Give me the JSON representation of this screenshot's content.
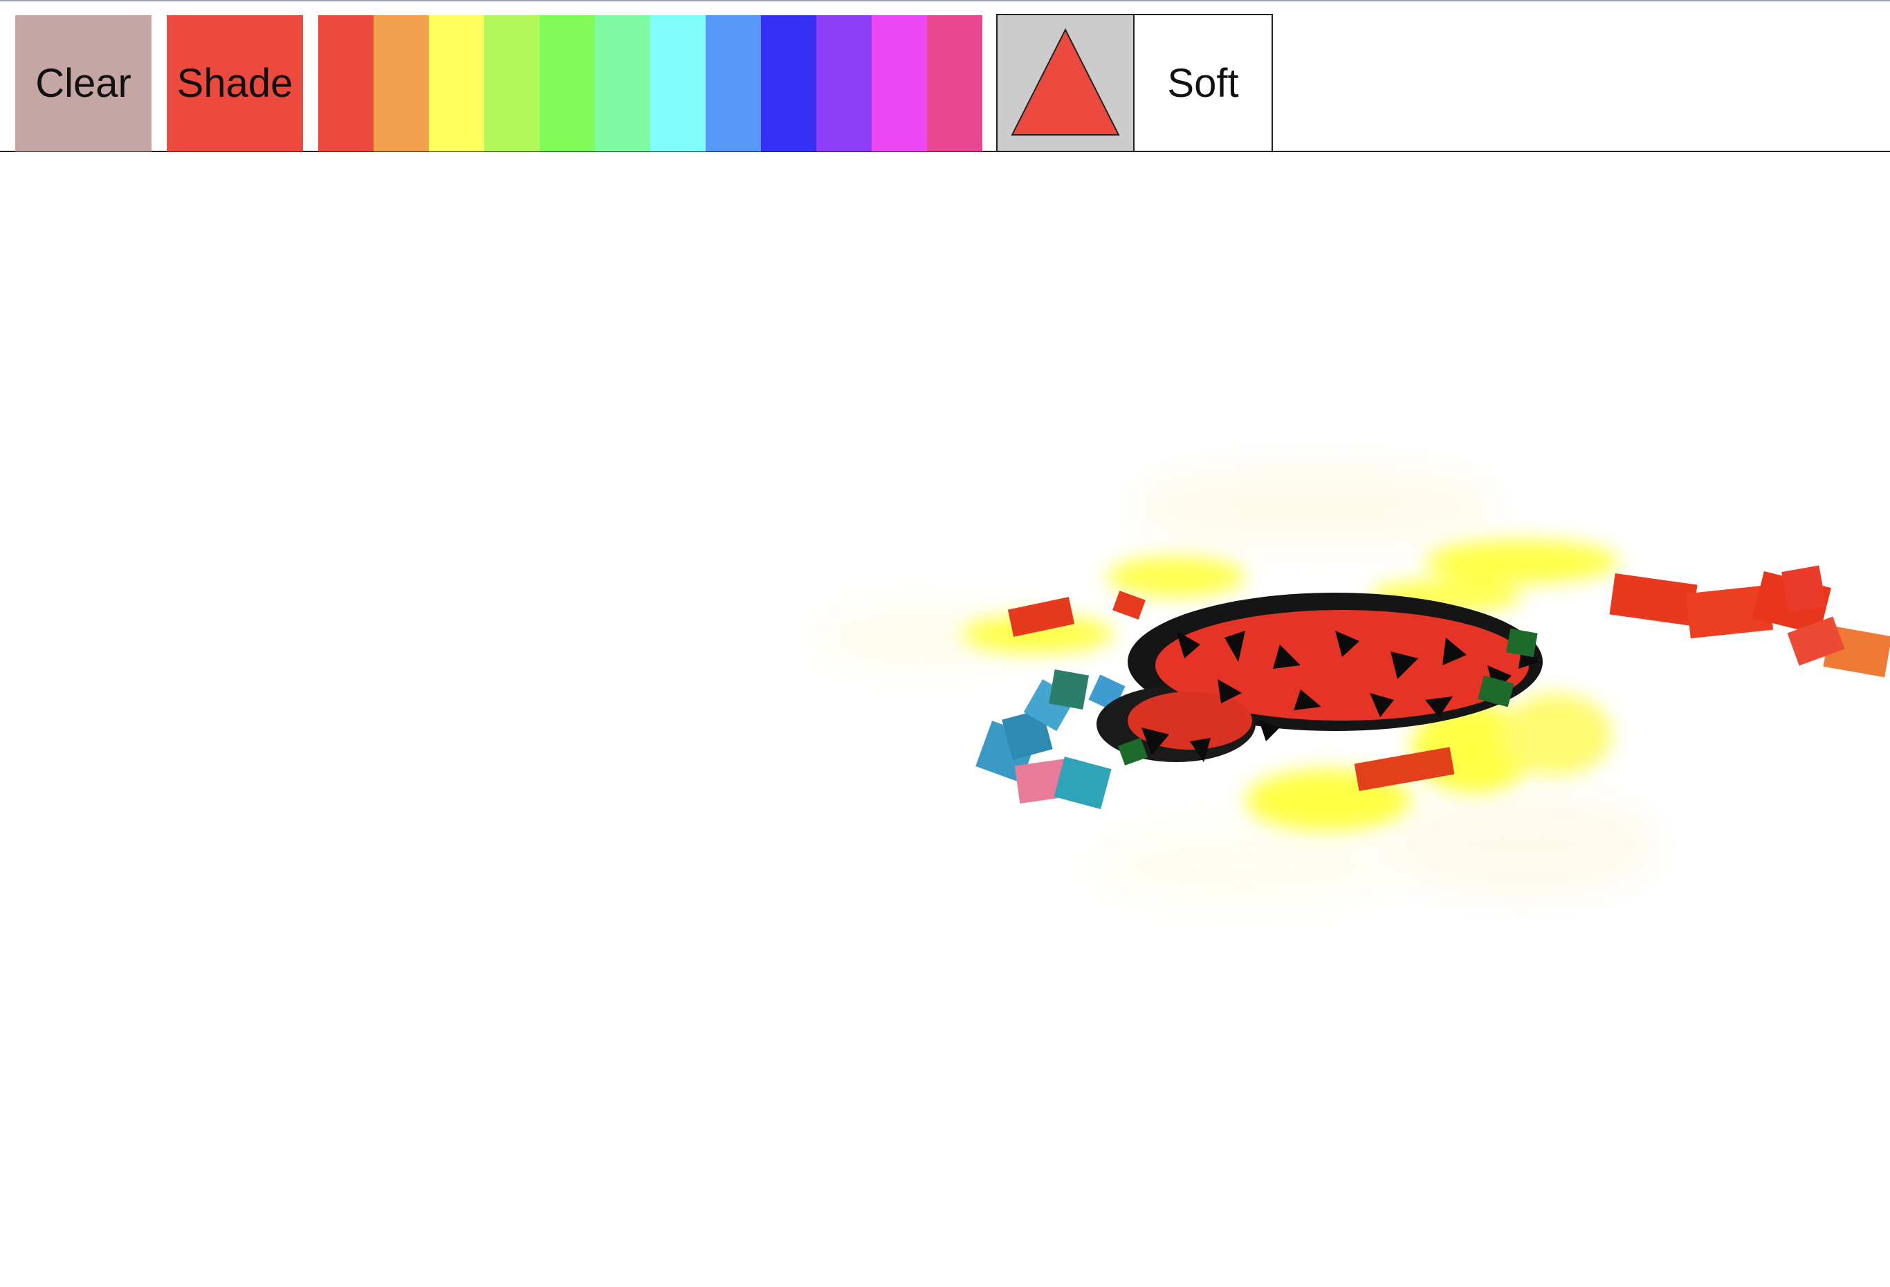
{
  "toolbar": {
    "clear_label": "Clear",
    "shade_label": "Shade",
    "soft_label": "Soft",
    "clear_color": "#c4a7a4",
    "shade_color": "#ec4a3f"
  },
  "palette": [
    {
      "color": "#ec4a3f"
    },
    {
      "color": "#f2a14e"
    },
    {
      "color": "#fefe5e"
    },
    {
      "color": "#b3f85a"
    },
    {
      "color": "#82fb5a"
    },
    {
      "color": "#7efba3"
    },
    {
      "color": "#80fcfb"
    },
    {
      "color": "#5598f8"
    },
    {
      "color": "#3431f5"
    },
    {
      "color": "#8e3ef6"
    },
    {
      "color": "#ec48f6"
    },
    {
      "color": "#ea4792"
    }
  ],
  "brush": {
    "shape_icon": "triangle-icon",
    "shape_color": "#ec4a3f"
  }
}
